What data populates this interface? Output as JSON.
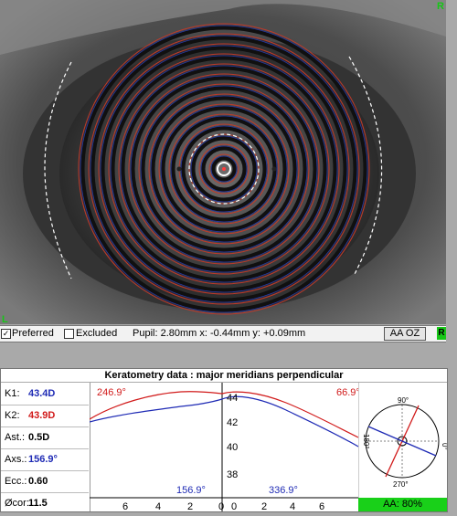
{
  "status_bar": {
    "preferred_checked": true,
    "preferred_label": "Preferred",
    "excluded_checked": false,
    "excluded_label": "Excluded",
    "measurements": "Pupil: 2.80mm x: -0.44mm y: +0.09mm",
    "aa_oz_label": "AA OZ",
    "r_corner": "R",
    "l_corner": "L",
    "top_right_corner": "R"
  },
  "keratometry": {
    "title": "Keratometry data : major meridians perpendicular",
    "metrics": [
      {
        "label": "K1:",
        "value": "43.4D",
        "color": "#1f2bb5"
      },
      {
        "label": "K2:",
        "value": "43.9D",
        "color": "#d11a1a"
      },
      {
        "label": "Ast.:",
        "value": "0.5D",
        "color": "#000000"
      },
      {
        "label": "Axs.:",
        "value": "156.9°",
        "color": "#1f2bb5"
      },
      {
        "label": "Ecc.:",
        "value": "0.60",
        "color": "#000000"
      },
      {
        "label": "Øcor:",
        "value": "11.5",
        "color": "#000000"
      }
    ],
    "left_plot": {
      "top_label": "246.9°",
      "bottom_label": "156.9°",
      "x_ticks": [
        "6",
        "4",
        "2",
        "0"
      ]
    },
    "right_plot": {
      "top_label": "66.9°",
      "bottom_label": "336.9°",
      "x_ticks": [
        "0",
        "2",
        "4",
        "6"
      ],
      "y_ticks": [
        "44",
        "42",
        "40",
        "38"
      ]
    },
    "compass": {
      "labels": [
        "90°",
        "180°",
        "0°",
        "270°"
      ]
    },
    "aa_badge": "AA: 80%"
  },
  "colors": {
    "red_curve": "#d11a1a",
    "blue_curve": "#1f2bb5",
    "accent_green": "#19d019"
  }
}
